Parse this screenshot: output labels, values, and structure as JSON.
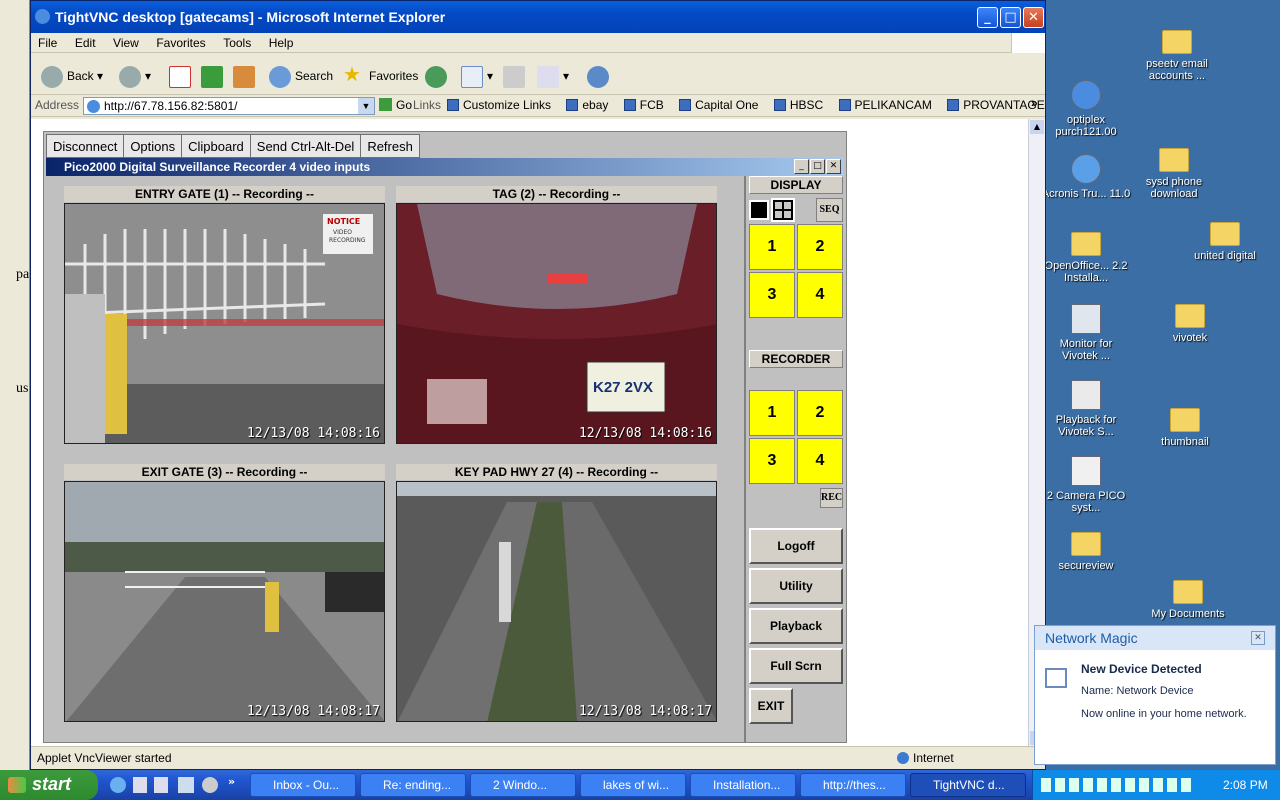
{
  "window": {
    "title": "TightVNC desktop [gatecams] - Microsoft Internet Explorer"
  },
  "menubar": [
    "File",
    "Edit",
    "View",
    "Favorites",
    "Tools",
    "Help"
  ],
  "toolbar": {
    "back": "Back",
    "search": "Search",
    "favorites": "Favorites"
  },
  "address": {
    "label": "Address",
    "url": "http://67.78.156.82:5801/",
    "go": "Go",
    "links_label": "Links"
  },
  "links": [
    "Customize Links",
    "ebay",
    "FCB",
    "Capital One",
    "HBSC",
    "PELIKANCAM",
    "PROVANTAGE"
  ],
  "status": {
    "text": "Applet VncViewer started",
    "zone": "Internet"
  },
  "vnc_buttons": [
    "Disconnect",
    "Options",
    "Clipboard",
    "Send Ctrl-Alt-Del",
    "Refresh"
  ],
  "pico": {
    "title": "Pico2000 Digital Surveillance Recorder 4 video inputs"
  },
  "cameras": [
    {
      "label": "ENTRY GATE (1) --  Recording  --",
      "timestamp": "12/13/08 14:08:16",
      "plate": ""
    },
    {
      "label": "TAG (2) --  Recording  --",
      "timestamp": "12/13/08 14:08:16",
      "plate": "K27 2VX"
    },
    {
      "label": "EXIT GATE (3) --  Recording  --",
      "timestamp": "12/13/08 14:08:17",
      "plate": ""
    },
    {
      "label": "KEY PAD HWY 27 (4) --  Recording  --",
      "timestamp": "12/13/08 14:08:17",
      "plate": ""
    }
  ],
  "sign": {
    "notice": "NOTICE",
    "line1": "VIDEO",
    "line2": "RECORDING"
  },
  "panel": {
    "display_label": "DISPLAY",
    "seq": "SEQ",
    "display_buttons": [
      "1",
      "2",
      "3",
      "4"
    ],
    "recorder_label": "RECORDER",
    "recorder_buttons": [
      "1",
      "2",
      "3",
      "4"
    ],
    "rec": "REC",
    "actions": [
      "Logoff",
      "Utility",
      "Playback",
      "Full Scrn",
      "EXIT"
    ]
  },
  "desktop_icons": [
    {
      "label": "pseetv email accounts ..."
    },
    {
      "label": "optiplex purch121.00"
    },
    {
      "label": "sysd phone download"
    },
    {
      "label": "Acronis Tru... 11.0"
    },
    {
      "label": "united digital"
    },
    {
      "label": "OpenOffice... 2.2 Installa..."
    },
    {
      "label": "Monitor for Vivotek ..."
    },
    {
      "label": "vivotek"
    },
    {
      "label": "Playback for Vivotek S..."
    },
    {
      "label": "thumbnail"
    },
    {
      "label": "2 Camera PICO syst..."
    },
    {
      "label": "secureview"
    },
    {
      "label": "My Documents"
    }
  ],
  "network_magic": {
    "title": "Network Magic",
    "heading": "New Device Detected",
    "name": "Name: Network Device",
    "message": "Now online in your home network."
  },
  "taskbar": {
    "start": "start",
    "tasks": [
      "Inbox - Ou...",
      "Re: ending...",
      "2 Windo...",
      "lakes of wi...",
      "Installation...",
      "http://thes...",
      "TightVNC d..."
    ],
    "clock": "2:08 PM"
  },
  "left_fragments": [
    "pa",
    "us"
  ]
}
